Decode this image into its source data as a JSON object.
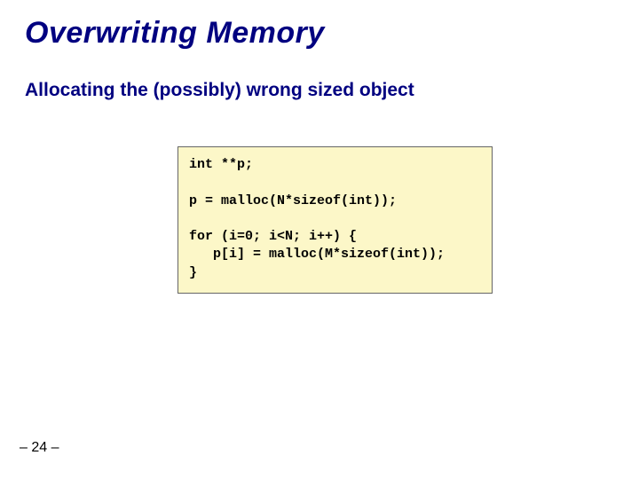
{
  "slide": {
    "title": "Overwriting Memory",
    "subtitle": "Allocating the (possibly) wrong sized object",
    "code": "int **p;\n\np = malloc(N*sizeof(int));\n\nfor (i=0; i<N; i++) {\n   p[i] = malloc(M*sizeof(int));\n}",
    "page": "– 24 –"
  }
}
